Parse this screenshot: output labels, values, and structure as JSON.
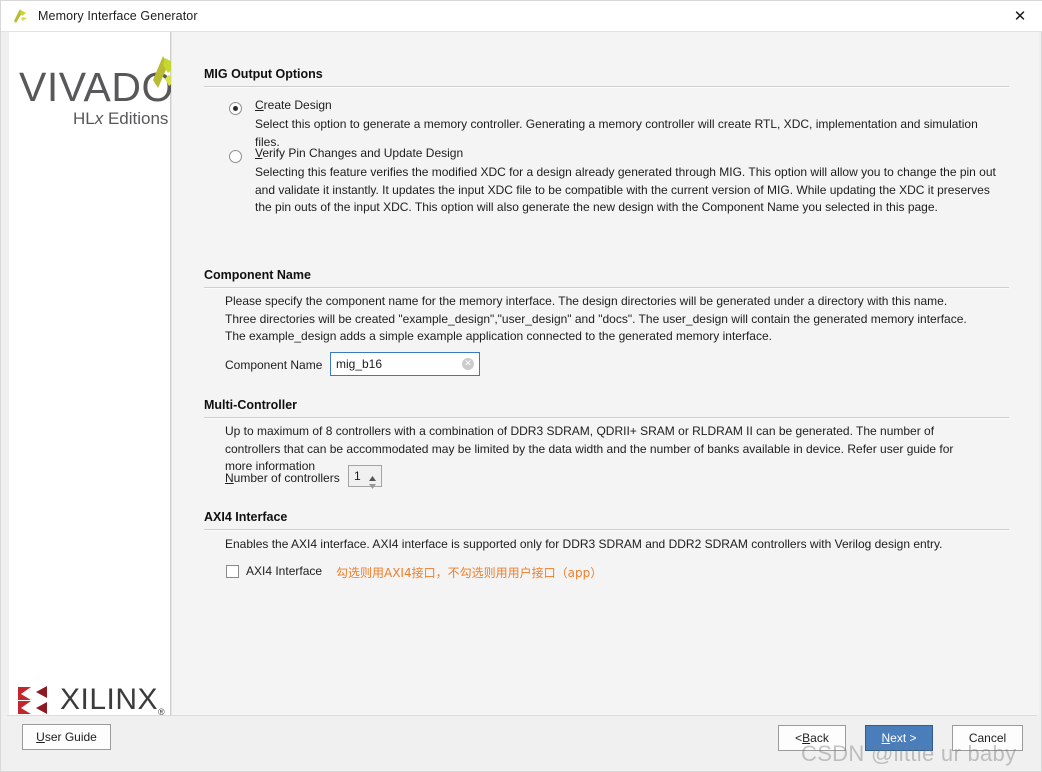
{
  "window": {
    "title": "Memory Interface Generator",
    "app_icon": "vivado-icon",
    "close_label": "✕"
  },
  "sidebar": {
    "vivado_wordmark": "VIVADO",
    "vivado_dot": ".",
    "vivado_subtitle_prefix": "HL",
    "vivado_subtitle_italic": "x",
    "vivado_subtitle_suffix": " Editions",
    "xilinx_wordmark": "XILINX",
    "xilinx_registered": "®"
  },
  "sections": {
    "mig_output_options": {
      "title": "MIG Output Options",
      "options": [
        {
          "mnemonic": "C",
          "label_rest": "reate Design",
          "selected": true,
          "description": "Select this option to generate a memory controller. Generating a memory controller will create RTL, XDC, implementation and simulation files."
        },
        {
          "mnemonic": "V",
          "label_rest": "erify Pin Changes and Update Design",
          "selected": false,
          "description": "Selecting this feature verifies the modified XDC for a design already generated through MIG. This option will allow you to change the pin out and validate it instantly. It updates the input XDC file to be compatible with the current version of MIG. While updating the XDC it preserves the pin outs of the input XDC. This option will also generate the new design with the Component Name you selected in this page."
        }
      ]
    },
    "component_name": {
      "title": "Component Name",
      "description": "Please specify the component name for the memory interface. The design directories will be generated under a directory with this name. Three directories will be created \"example_design\",\"user_design\" and \"docs\". The user_design will contain the generated memory interface. The example_design adds a simple example application connected to the generated memory interface.",
      "field_label": "Component Name",
      "field_value": "mig_b16",
      "clear_icon": "✕"
    },
    "multi_controller": {
      "title": "Multi-Controller",
      "description": "Up to maximum of 8 controllers with a combination of DDR3 SDRAM, QDRII+ SRAM or RLDRAM II can be generated. The number of controllers that can be accommodated may be limited by the data width and the number of banks available in device. Refer user guide for more information",
      "spinner_mnemonic": "N",
      "spinner_label_rest": "umber of controllers",
      "spinner_value": "1"
    },
    "axi4_interface": {
      "title": "AXI4 Interface",
      "description": "Enables the AXI4 interface. AXI4 interface is supported only for DDR3 SDRAM and DDR2 SDRAM controllers with Verilog design entry.",
      "checkbox_label": "AXI4 Interface",
      "checkbox_checked": false,
      "annotation": "勾选则用AXI4接口，不勾选则用用户接口（app）"
    }
  },
  "footer": {
    "user_guide_mnemonic": "U",
    "user_guide_rest": "ser Guide",
    "back_prefix": "< ",
    "back_mnemonic": "B",
    "back_rest": "ack",
    "next_mnemonic": "N",
    "next_rest": "ext >",
    "cancel_label": "Cancel"
  },
  "watermark": {
    "text": "CSDN @little ur baby"
  },
  "colors": {
    "accent_button": "#4a7ebb",
    "focus_border": "#3a79c4",
    "annotation": "#ef7e2a",
    "xilinx_red": "#c3262c",
    "vivado_green": "#c6d72e"
  }
}
